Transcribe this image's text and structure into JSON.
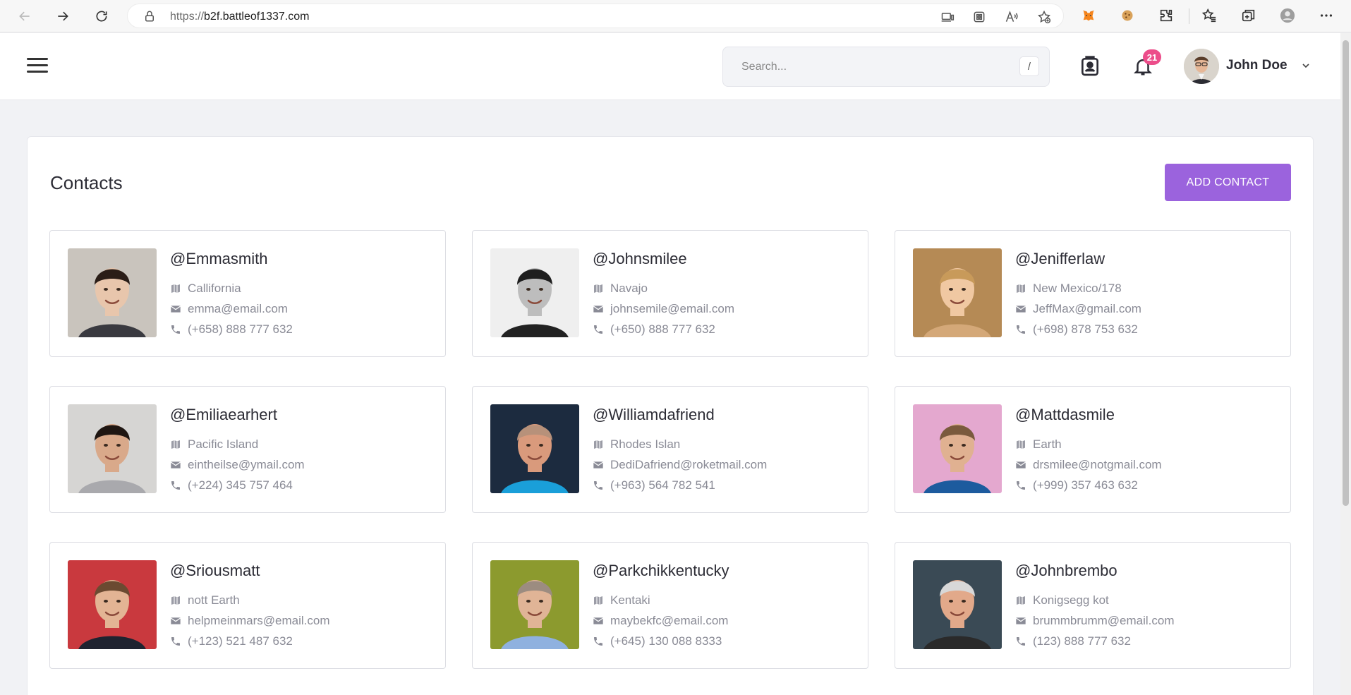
{
  "browser": {
    "url_protocol": "https://",
    "url_host": "b2f.battleof1337.com"
  },
  "header": {
    "search_placeholder": "Search...",
    "search_shortcut": "/",
    "notification_count": "21",
    "user_name": "John Doe"
  },
  "page": {
    "title": "Contacts",
    "add_button_label": "ADD CONTACT"
  },
  "contacts": [
    {
      "handle": "@Emmasmith",
      "location": "Callifornia",
      "email": "emma@email.com",
      "phone": "(+658) 888 777 632",
      "photo_bg": "#c9c4bd",
      "skin": "#e8c6ac",
      "hair": "#2a1d17",
      "shirt": "#3a3a40"
    },
    {
      "handle": "@Johnsmilee",
      "location": "Navajo",
      "email": "johnsemile@email.com",
      "phone": "(+650) 888 777 632",
      "photo_bg": "#efefef",
      "skin": "#bdbdbd",
      "hair": "#1e1e1e",
      "shirt": "#222222"
    },
    {
      "handle": "@Jenifferlaw",
      "location": "New Mexico/178",
      "email": "JeffMax@gmail.com",
      "phone": "(+698) 878 753 632",
      "photo_bg": "#b58a55",
      "skin": "#f0c8a2",
      "hair": "#c89a5a",
      "shirt": "#d4a878"
    },
    {
      "handle": "@Emiliaearhert",
      "location": "Pacific Island",
      "email": "eintheilse@ymail.com",
      "phone": "(+224) 345 757 464",
      "photo_bg": "#d6d5d3",
      "skin": "#d9a98a",
      "hair": "#1f1612",
      "shirt": "#a9a9ad"
    },
    {
      "handle": "@Williamdafriend",
      "location": "Rhodes Islan",
      "email": "DediDafriend@roketmail.com",
      "phone": "(+963) 564 782 541",
      "photo_bg": "#1c2b3f",
      "skin": "#d99a7c",
      "hair": "#b7917a",
      "shirt": "#1a9fd9"
    },
    {
      "handle": "@Mattdasmile",
      "location": "Earth",
      "email": "drsmilee@notgmail.com",
      "phone": "(+999) 357 463 632",
      "photo_bg": "#e4a8cf",
      "skin": "#e0b191",
      "hair": "#7a5a3d",
      "shirt": "#1d5b9e"
    },
    {
      "handle": "@Sriousmatt",
      "location": "nott Earth",
      "email": "helpmeinmars@email.com",
      "phone": "(+123) 521 487 632",
      "photo_bg": "#c9393e",
      "skin": "#e3b494",
      "hair": "#6b4a31",
      "shirt": "#1f2330"
    },
    {
      "handle": "@Parkchikkentucky",
      "location": "Kentaki",
      "email": "maybekfc@email.com",
      "phone": "(+645) 130 088 8333",
      "photo_bg": "#8c9a2e",
      "skin": "#e0b496",
      "hair": "#9c8c80",
      "shirt": "#8fb1df"
    },
    {
      "handle": "@Johnbrembo",
      "location": "Konigsegg kot",
      "email": "brummbrumm@email.com",
      "phone": "(123) 888 777 632",
      "photo_bg": "#3a4a55",
      "skin": "#e2a98a",
      "hair": "#d8d8d8",
      "shirt": "#2a2a2a"
    }
  ]
}
